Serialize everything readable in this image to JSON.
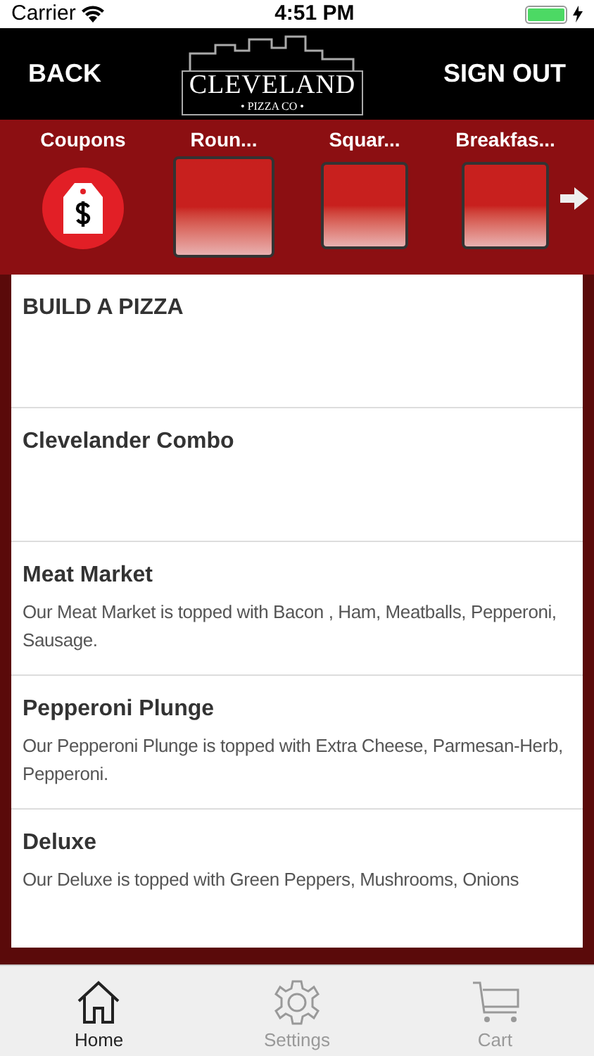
{
  "status_bar": {
    "carrier": "Carrier",
    "time": "4:51 PM"
  },
  "nav": {
    "back": "BACK",
    "logo": {
      "name": "CLEVELAND",
      "tagline": "• PIZZA CO •"
    },
    "sign_out": "SIGN OUT"
  },
  "categories": [
    {
      "label": "Coupons",
      "kind": "coupon"
    },
    {
      "label": "Roun...",
      "kind": "tile",
      "selected": true
    },
    {
      "label": "Squar...",
      "kind": "tile",
      "selected": false
    },
    {
      "label": "Breakfas...",
      "kind": "tile",
      "selected": false
    }
  ],
  "menu_items": [
    {
      "title": "BUILD A PIZZA"
    },
    {
      "title": "Clevelander Combo"
    },
    {
      "title": "Meat Market",
      "description": "Our Meat Market is topped with Bacon , Ham, Meatballs, Pepperoni, Sausage."
    },
    {
      "title": "Pepperoni Plunge",
      "description": "Our Pepperoni Plunge is topped with Extra Cheese, Parmesan-Herb, Pepperoni."
    },
    {
      "title": "Deluxe",
      "description": "Our Deluxe is topped with Green Peppers, Mushrooms, Onions"
    }
  ],
  "tab_bar": [
    {
      "label": "Home",
      "kind": "home",
      "selected": true
    },
    {
      "label": "Settings",
      "kind": "settings",
      "selected": false
    },
    {
      "label": "Cart",
      "kind": "cart",
      "selected": false
    }
  ]
}
